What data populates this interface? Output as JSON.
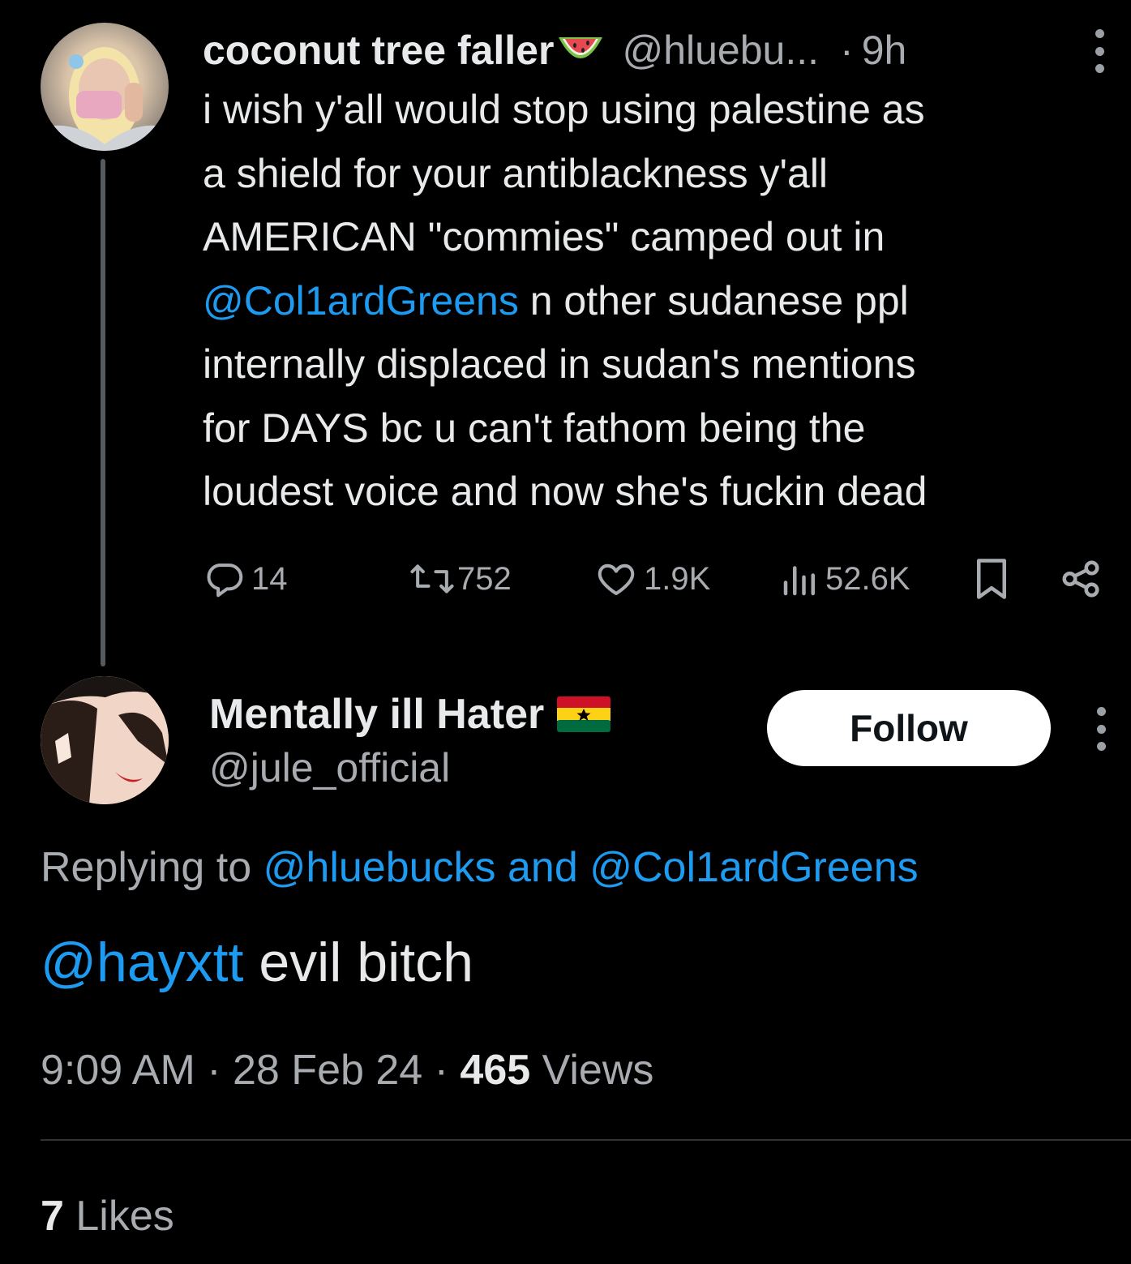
{
  "parent_tweet": {
    "display_name": "coconut tree faller",
    "name_emoji": "watermelon",
    "handle": "@hluebu...",
    "separator": "·",
    "time": "9h",
    "text_lines": [
      {
        "plain": "i wish y'all would stop using palestine as"
      },
      {
        "plain": "a shield for your antiblackness y'all"
      },
      {
        "plain": "AMERICAN \"commies\" camped out in"
      },
      {
        "mention": "@Col1ardGreens",
        "plain": " n other sudanese ppl"
      },
      {
        "plain": "internally displaced in sudan's mentions"
      },
      {
        "plain": "for DAYS bc u can't fathom being the"
      },
      {
        "plain": "loudest voice and now she's fuckin dead"
      }
    ],
    "actions": {
      "replies": "14",
      "reposts": "752",
      "likes": "1.9K",
      "views": "52.6K"
    }
  },
  "main_tweet": {
    "display_name": "Mentally ill Hater",
    "name_emoji": "ghana-flag",
    "handle": "@jule_official",
    "follow_label": "Follow",
    "replying_prefix": "Replying to ",
    "replying_user1": "@hluebucks",
    "replying_and": " and ",
    "replying_user2": "@Col1ardGreens",
    "mention": "@hayxtt",
    "text": " evil bitch",
    "time": "9:09 AM",
    "sep1": " · ",
    "date": "28 Feb 24",
    "sep2": " · ",
    "views_count": "465",
    "views_label": " Views",
    "likes_count": "7",
    "likes_label": " Likes"
  },
  "colors": {
    "background": "#000000",
    "text": "#e7e9ea",
    "secondary": "#a8acb0",
    "link": "#1d9bf0",
    "follow_bg": "#ffffff"
  },
  "icons": [
    "reply-icon",
    "repost-icon",
    "like-icon",
    "views-icon",
    "bookmark-icon",
    "share-icon",
    "more-icon"
  ]
}
